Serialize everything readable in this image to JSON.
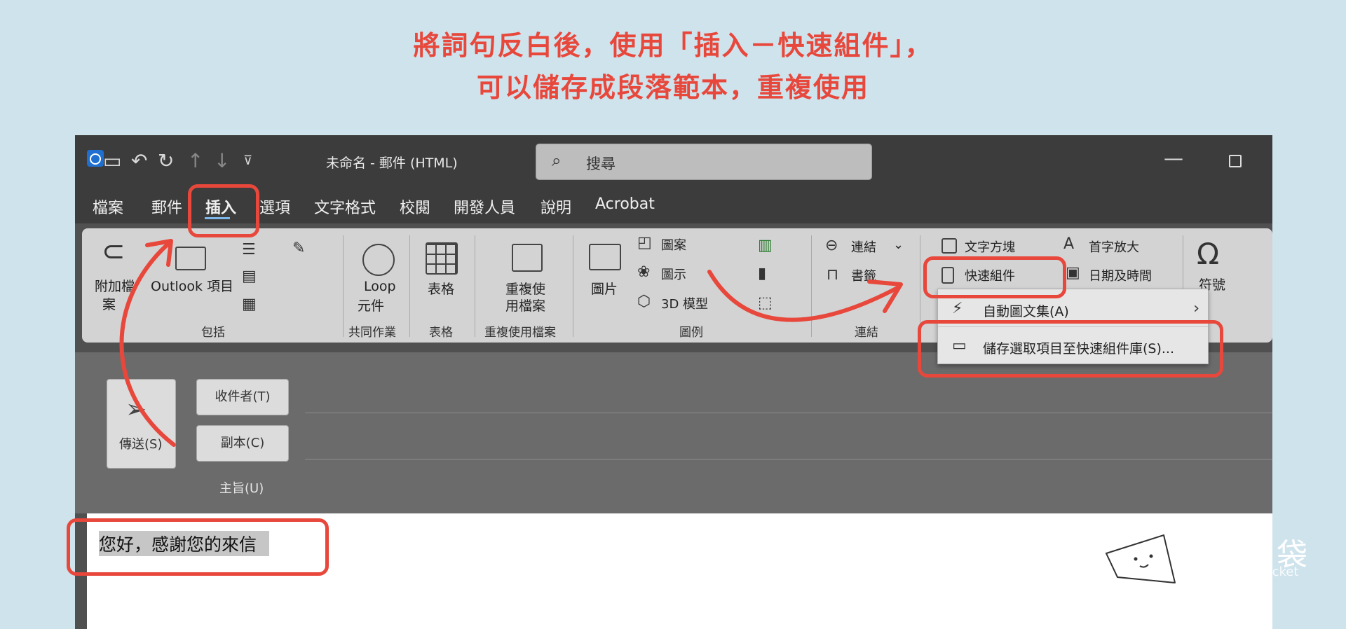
{
  "caption": {
    "line1": "將詞句反白後，使用「插入－快速組件」，",
    "line2": "可以儲存成段落範本，重複使用"
  },
  "window": {
    "title": "未命名 - 郵件 (HTML)",
    "search_placeholder": "搜尋"
  },
  "tabs": [
    "檔案",
    "郵件",
    "插入",
    "選項",
    "文字格式",
    "校閱",
    "開發人員",
    "說明",
    "Acrobat"
  ],
  "active_tab": "插入",
  "ribbon": {
    "include": {
      "attach_line1": "附加檔",
      "attach_line2": "案",
      "outlook_item": "Outlook 項目",
      "group": "包括"
    },
    "collab": {
      "loop_line1": "Loop",
      "loop_line2": "元件",
      "group": "共同作業"
    },
    "tables": {
      "table": "表格",
      "group": "表格"
    },
    "reuse": {
      "line1": "重複使",
      "line2": "用檔案",
      "group": "重複使用檔案"
    },
    "illustrations": {
      "pictures": "圖片",
      "shapes": "圖案",
      "icons": "圖示",
      "models3d": "3D 模型",
      "group": "圖例"
    },
    "links": {
      "link": "連結",
      "bookmark": "書籤",
      "group": "連結"
    },
    "text": {
      "textbox": "文字方塊",
      "quickparts": "快速組件",
      "dropcap": "首字放大",
      "datetime": "日期及時間"
    },
    "symbols": {
      "symbol": "符號"
    }
  },
  "quickparts_menu": {
    "autotext": "自動圖文集(A)",
    "save_selection": "儲存選取項目至快速組件庫(S)..."
  },
  "compose": {
    "send": "傳送(S)",
    "to": "收件者(T)",
    "cc": "副本(C)",
    "subject": "主旨(U)",
    "body": "您好，感謝您的來信"
  },
  "watermark": {
    "name": "淺口袋",
    "subtitle": "Money Pocket"
  },
  "colors": {
    "accent": "#e8473b",
    "background": "#cfe3ec",
    "tab_underline": "#7db6e8"
  }
}
